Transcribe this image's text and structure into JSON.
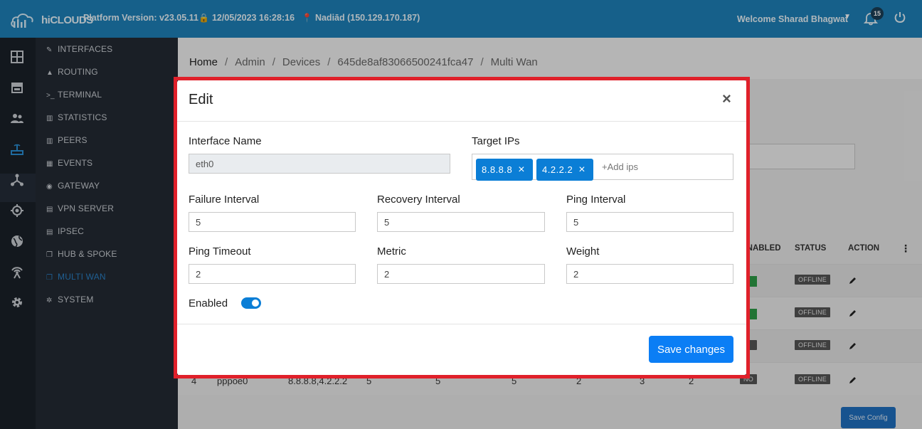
{
  "topbar": {
    "logo_text": "hiCLOUDS",
    "platform_version": "Platform Version: v23.05.11",
    "datetime": "12/05/2023 16:28:16",
    "location": "Nadiād (150.129.170.187)",
    "welcome": "Welcome Sharad Bhagwat",
    "notification_count": "15",
    "bar_color": "#1e80b8"
  },
  "rail": {
    "icons": [
      "dashboard-icon",
      "store-icon",
      "users-icon",
      "router-icon",
      "network-icon",
      "target-icon",
      "globe-icon",
      "antenna-icon",
      "gear-icon"
    ],
    "active_index": 3
  },
  "subnav": {
    "items": [
      {
        "label": "INTERFACES",
        "icon": "wrench-icon"
      },
      {
        "label": "ROUTING",
        "icon": "road-icon"
      },
      {
        "label": "TERMINAL",
        "icon": "terminal-icon"
      },
      {
        "label": "STATISTICS",
        "icon": "bar-chart-icon"
      },
      {
        "label": "PEERS",
        "icon": "bar-chart-icon"
      },
      {
        "label": "EVENTS",
        "icon": "calendar-icon"
      },
      {
        "label": "GATEWAY",
        "icon": "podcast-icon"
      },
      {
        "label": "VPN SERVER",
        "icon": "server-icon"
      },
      {
        "label": "IPSEC",
        "icon": "server-icon"
      },
      {
        "label": "HUB & SPOKE",
        "icon": "copy-icon"
      },
      {
        "label": "MULTI WAN",
        "icon": "copy-icon"
      },
      {
        "label": "SYSTEM",
        "icon": "gear-icon"
      }
    ],
    "active_label": "MULTI WAN",
    "active_color": "#2a7fc4"
  },
  "breadcrumb": {
    "home": "Home",
    "admin": "Admin",
    "devices": "Devices",
    "device_id": "645de8af83066500241fca47",
    "page": "Multi Wan",
    "separator": "/"
  },
  "table": {
    "headers": {
      "enabled": "ENABLED",
      "status": "STATUS",
      "action": "ACTION"
    },
    "rows": [
      {
        "status": "OFFLINE"
      },
      {
        "status": "OFFLINE"
      },
      {
        "status": "OFFLINE"
      },
      {
        "index": "4",
        "name": "pppoe0",
        "ips": "8.8.8.8,4.2.2.2",
        "failure": "5",
        "recovery": "5",
        "ping": "5",
        "timeout": "2",
        "metric": "3",
        "weight": "2",
        "enabled": "NO",
        "status": "OFFLINE"
      }
    ],
    "save_config": "Save Config"
  },
  "modal": {
    "title": "Edit",
    "close": "×",
    "interface_name": {
      "label": "Interface Name",
      "value": "eth0"
    },
    "target_ips": {
      "label": "Target IPs",
      "tags": [
        "8.8.8.8",
        "4.2.2.2"
      ],
      "placeholder": "+Add ips"
    },
    "failure_interval": {
      "label": "Failure Interval",
      "value": "5"
    },
    "recovery_interval": {
      "label": "Recovery Interval",
      "value": "5"
    },
    "ping_interval": {
      "label": "Ping Interval",
      "value": "5"
    },
    "ping_timeout": {
      "label": "Ping Timeout",
      "value": "2"
    },
    "metric": {
      "label": "Metric",
      "value": "2"
    },
    "weight": {
      "label": "Weight",
      "value": "2"
    },
    "enabled": {
      "label": "Enabled",
      "on": true
    },
    "save_button": "Save changes",
    "accent_color": "#0b7ef5",
    "highlight_color": "#e0202a"
  }
}
